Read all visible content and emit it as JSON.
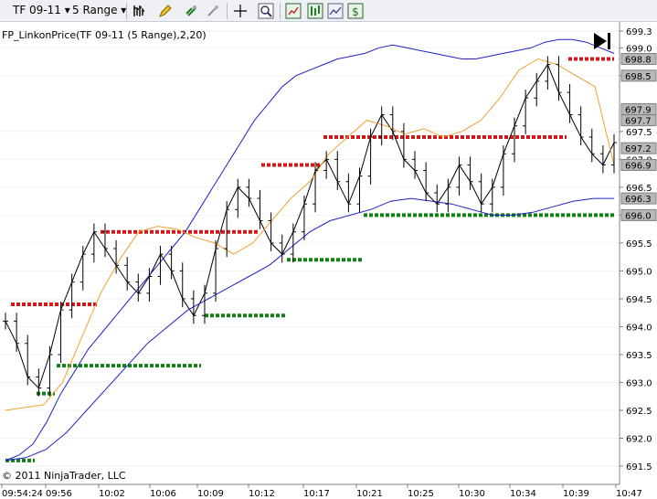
{
  "toolbar": {
    "instrument": "TF 09-11 ▾",
    "bar_type": "5 Range ▾",
    "icons": [
      "bar-style-icon",
      "pencil-draw-icon",
      "magnet-icon",
      "pointer-icon",
      "crosshair-icon",
      "zoom-icon",
      "indicators-icon",
      "strategies-icon",
      "chart-properties-icon",
      "dollar-icon"
    ]
  },
  "chart": {
    "indicator_label": "FP_LinkonPrice(TF 09-11 (5 Range),2,20)",
    "copyright": "© 2011 NinjaTrader, LLC",
    "colors": {
      "bars": "#000000",
      "upper_band": "#2020c8",
      "lower_band": "#2020c8",
      "orange": "#f0a030",
      "red": "#d01818",
      "green": "#108010",
      "price_box": "#b8b8b8"
    }
  },
  "chart_data": {
    "type": "line",
    "y_ticks": [
      "699.3",
      "699.0",
      "698.5",
      "697.5",
      "697.0",
      "696.5",
      "696.0",
      "695.5",
      "695.0",
      "694.5",
      "694.0",
      "693.5",
      "693.0",
      "692.5",
      "692.0",
      "691.5"
    ],
    "ylim": [
      691.3,
      699.3
    ],
    "x_ticks": [
      "09:54:24",
      "09:56",
      "10:02",
      "10:06",
      "10:09",
      "10:12",
      "10:17",
      "10:21",
      "10:25",
      "10:30",
      "10:34",
      "10:39",
      "10:47"
    ],
    "price_markers": [
      "698.8",
      "698.5",
      "697.9",
      "697.7",
      "697.2",
      "696.9",
      "696.3",
      "696.0"
    ],
    "series": [
      {
        "values": [
          694.1,
          693.7,
          693.1,
          692.9,
          693.5,
          694.3,
          694.8,
          695.3,
          695.7,
          695.4,
          695.1,
          694.8,
          694.6,
          694.9,
          695.3,
          695.0,
          694.5,
          694.2,
          694.6,
          695.4,
          696.1,
          696.5,
          696.3,
          695.9,
          695.5,
          695.3,
          695.7,
          696.2,
          696.8,
          697.0,
          696.6,
          696.2,
          696.7,
          697.4,
          697.8,
          697.5,
          697.0,
          696.8,
          696.4,
          696.2,
          696.5,
          696.9,
          696.6,
          696.2,
          696.5,
          697.1,
          697.6,
          698.1,
          698.4,
          698.7,
          698.2,
          697.8,
          697.4,
          697.1,
          696.9,
          697.3
        ]
      },
      {
        "values": [
          691.6,
          691.7,
          691.9,
          692.3,
          692.8,
          693.2,
          693.6,
          693.9,
          694.2,
          694.5,
          694.8,
          695.1,
          695.4,
          695.7,
          696.1,
          696.5,
          696.9,
          697.3,
          697.7,
          698.0,
          698.3,
          698.5,
          698.6,
          698.7,
          698.8,
          698.85,
          698.9,
          699.0,
          699.05,
          699.0,
          698.95,
          698.9,
          698.85,
          698.8,
          698.8,
          698.85,
          698.9,
          698.95,
          699.0,
          699.1,
          699.15,
          699.15,
          699.1,
          699.0,
          698.9
        ]
      },
      {
        "values": [
          691.6,
          691.65,
          691.8,
          692.1,
          692.5,
          692.9,
          693.3,
          693.7,
          694.0,
          694.3,
          694.5,
          694.7,
          694.9,
          695.1,
          695.4,
          695.7,
          695.9,
          696.0,
          696.1,
          696.25,
          696.3,
          696.25,
          696.2,
          696.1,
          696.0,
          696.0,
          696.05,
          696.15,
          696.25,
          696.3,
          696.3
        ]
      },
      {
        "values": [
          692.5,
          692.55,
          692.6,
          693.0,
          693.8,
          694.6,
          695.2,
          695.7,
          695.8,
          695.75,
          695.6,
          695.5,
          695.3,
          695.5,
          695.9,
          696.3,
          696.6,
          697.1,
          697.4,
          697.7,
          697.6,
          697.45,
          697.55,
          697.4,
          697.5,
          697.7,
          698.1,
          698.6,
          698.8,
          698.7,
          698.5,
          698.3,
          696.9
        ]
      }
    ],
    "support_resistance": [
      {
        "y": 694.4,
        "color": "red"
      },
      {
        "y": 695.7,
        "color": "red"
      },
      {
        "y": 696.9,
        "color": "red"
      },
      {
        "y": 697.4,
        "color": "red"
      },
      {
        "y": 698.8,
        "color": "red"
      },
      {
        "y": 692.8,
        "color": "green"
      },
      {
        "y": 693.3,
        "color": "green"
      },
      {
        "y": 691.6,
        "color": "green"
      },
      {
        "y": 694.2,
        "color": "green"
      },
      {
        "y": 695.2,
        "color": "green"
      },
      {
        "y": 696.0,
        "color": "green"
      }
    ]
  }
}
